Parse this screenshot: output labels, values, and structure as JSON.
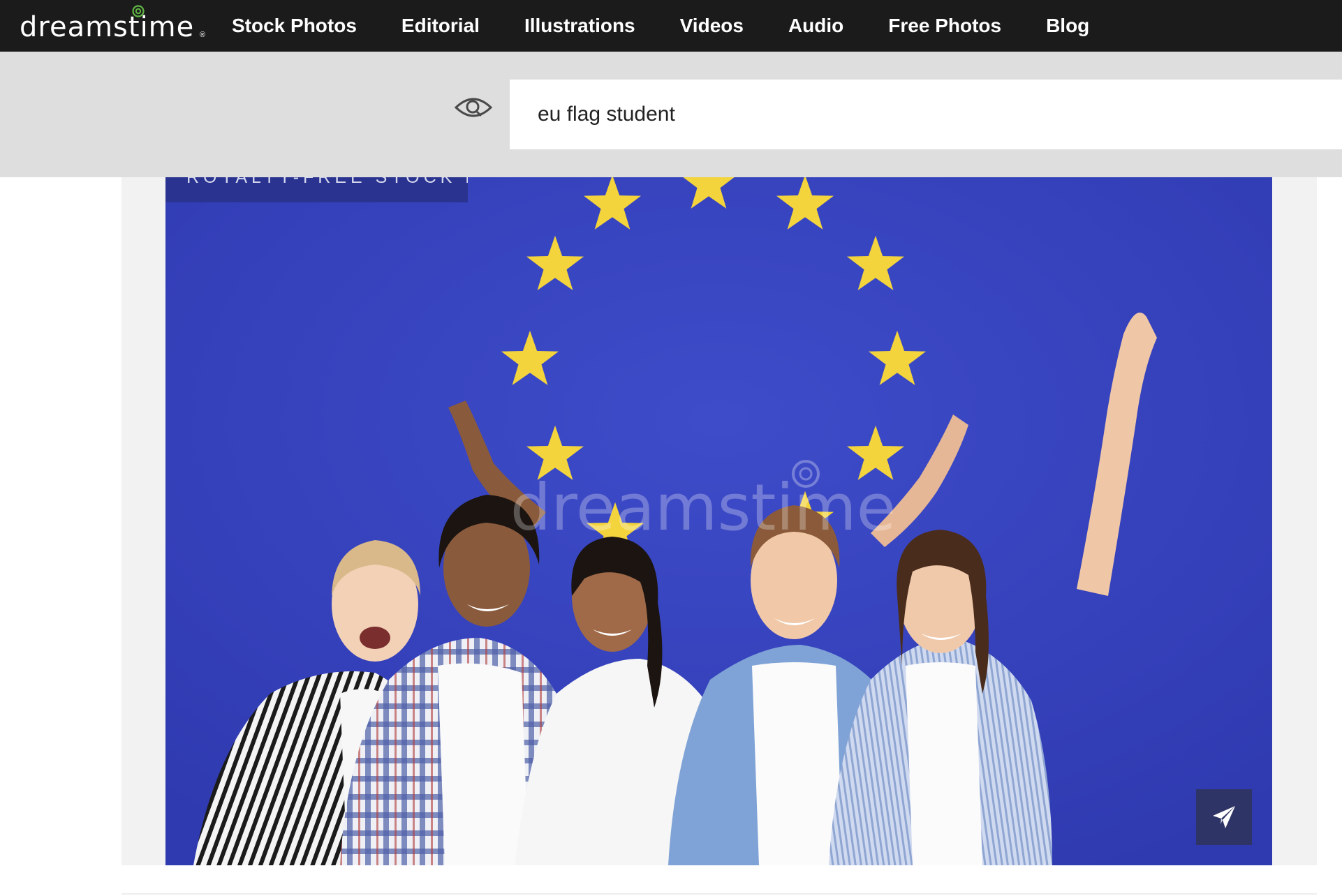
{
  "brand": {
    "logo_text": "dreamstime",
    "logo_reg": "®",
    "swirl_color": "#5fb544"
  },
  "nav": {
    "items": [
      {
        "label": "Stock Photos"
      },
      {
        "label": "Editorial"
      },
      {
        "label": "Illustrations"
      },
      {
        "label": "Videos"
      },
      {
        "label": "Audio"
      },
      {
        "label": "Free Photos"
      },
      {
        "label": "Blog"
      }
    ]
  },
  "search": {
    "value": "eu flag student",
    "icon": "eye-search-icon"
  },
  "photo": {
    "badge": "ROYALTY-FREE STOCK PHOTO",
    "watermark": "dreamstime",
    "flag_blue": "#3a47c2",
    "star_color": "#f3d43d"
  },
  "share": {
    "icon": "paper-plane-icon"
  }
}
